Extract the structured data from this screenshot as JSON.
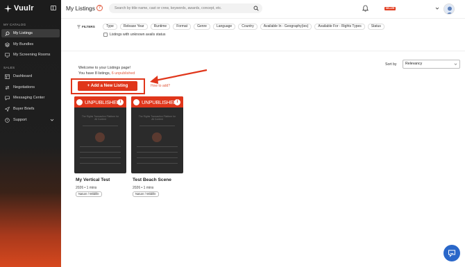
{
  "brand": {
    "name": "Vuulr"
  },
  "sidebar": {
    "sections": [
      {
        "label": "MY CATALOG"
      },
      {
        "label": "SALES"
      }
    ],
    "items": [
      {
        "label": "My Listings",
        "icon": "search-icon",
        "active": true
      },
      {
        "label": "My Bundles",
        "icon": "layers-icon"
      },
      {
        "label": "My Screening Rooms",
        "icon": "monitor-icon"
      },
      {
        "label": "Dashboard",
        "icon": "dashboard-icon"
      },
      {
        "label": "Negotiations",
        "icon": "exchange-icon"
      },
      {
        "label": "Messaging Center",
        "icon": "chat-icon"
      },
      {
        "label": "Buyer Briefs",
        "icon": "send-icon"
      },
      {
        "label": "Support",
        "icon": "help-circle-icon"
      }
    ]
  },
  "header": {
    "title": "My Listings",
    "help": "?",
    "search_placeholder": "Search by title name, cast or crew, keywords, awards, concept, etc.",
    "badge": "SELLER"
  },
  "filters": {
    "label": "FILTERS",
    "chips": [
      "Type",
      "Release Year",
      "Runtime",
      "Format",
      "Genre",
      "Language",
      "Country",
      "Available In - Geography(ies)",
      "Available For - Rights Types",
      "Status"
    ],
    "unknown_avails": "Listings with unknown avails status"
  },
  "sort": {
    "label": "Sort by",
    "value": "Relevancy"
  },
  "welcome": {
    "line1": "Welcome to your Listings page!",
    "line2_prefix": "You have 8 listings, ",
    "line2_link": "6 unpublished"
  },
  "actions": {
    "add_listing": "+ Add a New Listing",
    "how_to": "How to add?"
  },
  "listings": [
    {
      "status": "UNPUBLISHED",
      "poster_text": "The Rights Transaction Platform for All Content",
      "title": "My Vertical Test",
      "meta": "2026 • 1 mins",
      "tag": "Nature / Wildlife"
    },
    {
      "status": "UNPUBLISHED",
      "poster_text": "The Rights Transaction Platform for All Content",
      "title": "Test Beach Scene",
      "meta": "2026 • 1 mins",
      "tag": "Nature / Wildlife"
    }
  ],
  "colors": {
    "accent": "#e0361b",
    "chat_button": "#2a67c9",
    "sidebar_bg": "#1c1c1c"
  }
}
